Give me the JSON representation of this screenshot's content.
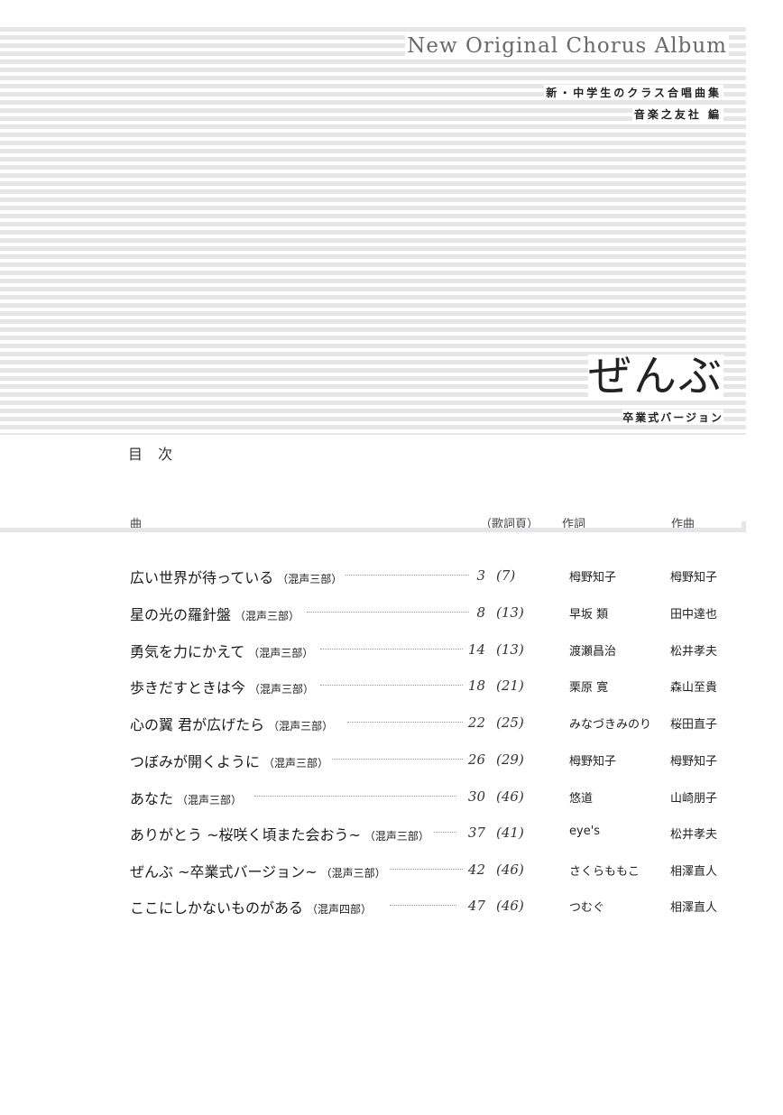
{
  "header": {
    "series_title": "New Original Chorus Album",
    "subtitle_line1": "新・中学生のクラス合唱曲集",
    "subtitle_line2": "音楽之友社 編",
    "main_title": "ぜんぶ",
    "version_title": "卒業式バージョン"
  },
  "toc": {
    "heading": "目 次",
    "columns": {
      "song": "曲",
      "page": "（歌詞頁）",
      "lyricist": "作詞",
      "composer": "作曲"
    },
    "rows": [
      {
        "title": "広い世界が待っている",
        "voice": "（混声三部）",
        "page": "3",
        "lyrics_page": "(7)",
        "lyricist": "栂野知子",
        "composer": "栂野知子"
      },
      {
        "title": "星の光の羅針盤",
        "voice": "（混声三部）",
        "page": "8",
        "lyrics_page": "(13)",
        "lyricist": "早坂 類",
        "composer": "田中達也"
      },
      {
        "title": "勇気を力にかえて",
        "voice": "（混声三部）",
        "page": "14",
        "lyrics_page": "(13)",
        "lyricist": "渡瀬昌治",
        "composer": "松井孝夫"
      },
      {
        "title": "歩きだすときは今",
        "voice": "（混声三部）",
        "page": "18",
        "lyrics_page": "(21)",
        "lyricist": "栗原 寛",
        "composer": "森山至貴"
      },
      {
        "title": "心の翼 君が広げたら",
        "voice": "（混声三部）",
        "page": "22",
        "lyrics_page": "(25)",
        "lyricist": "みなづきみのり",
        "composer": "桜田直子"
      },
      {
        "title": "つぼみが開くように",
        "voice": "（混声三部）",
        "page": "26",
        "lyrics_page": "(29)",
        "lyricist": "栂野知子",
        "composer": "栂野知子"
      },
      {
        "title": "あなた",
        "voice": "（混声三部）",
        "page": "30",
        "lyrics_page": "(46)",
        "lyricist": "悠道",
        "composer": "山崎朋子"
      },
      {
        "title": "ありがとう ~桜咲く頃また会おう~",
        "voice": "（混声三部）",
        "page": "37",
        "lyrics_page": "(41)",
        "lyricist": "eye's",
        "composer": "松井孝夫"
      },
      {
        "title": "ぜんぶ ~卒業式バージョン~",
        "voice": "（混声三部）",
        "page": "42",
        "lyrics_page": "(46)",
        "lyricist": "さくらももこ",
        "composer": "相澤直人"
      },
      {
        "title": "ここにしかないものがある",
        "voice": "（混声四部）",
        "page": "47",
        "lyrics_page": "(46)",
        "lyricist": "つむぐ",
        "composer": "相澤直人"
      }
    ]
  }
}
